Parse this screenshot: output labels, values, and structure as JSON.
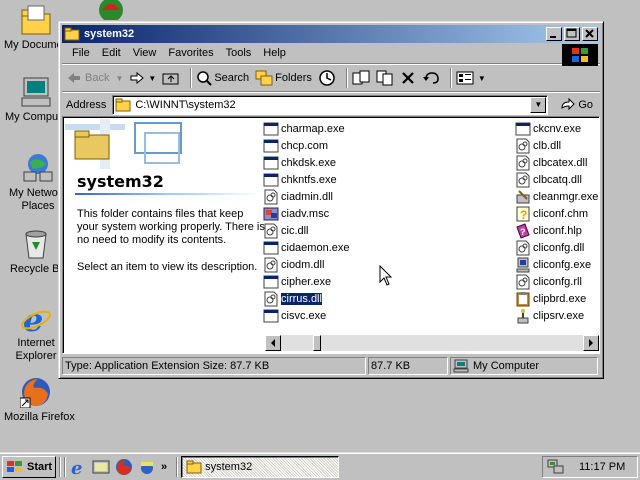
{
  "desktop": {
    "icons": [
      {
        "label": "My Documents",
        "icon": "my-documents-icon"
      },
      {
        "label": "My Computer",
        "icon": "my-computer-icon"
      },
      {
        "label": "My Network Places",
        "icon": "network-places-icon"
      },
      {
        "label": "Recycle Bin",
        "icon": "recycle-bin-icon"
      },
      {
        "label": "Internet Explorer",
        "icon": "internet-explorer-icon"
      },
      {
        "label": "Mozilla Firefox",
        "icon": "firefox-icon"
      }
    ]
  },
  "window": {
    "title": "system32",
    "menu": [
      "File",
      "Edit",
      "View",
      "Favorites",
      "Tools",
      "Help"
    ],
    "toolbar": {
      "back": "Back",
      "search": "Search",
      "folders": "Folders"
    },
    "address": {
      "label": "Address",
      "value": "C:\\WINNT\\system32",
      "go": "Go"
    },
    "left_pane": {
      "title": "system32",
      "description": "This folder contains files that keep your system working properly. There is no need to modify its contents.",
      "hint": "Select an item to view its description."
    },
    "files_col1": [
      {
        "name": "charmap.exe",
        "icon": "app-icon"
      },
      {
        "name": "chcp.com",
        "icon": "app-icon"
      },
      {
        "name": "chkdsk.exe",
        "icon": "app-icon"
      },
      {
        "name": "chkntfs.exe",
        "icon": "app-icon"
      },
      {
        "name": "ciadmin.dll",
        "icon": "dll-icon"
      },
      {
        "name": "ciadv.msc",
        "icon": "msc-icon"
      },
      {
        "name": "cic.dll",
        "icon": "dll-icon"
      },
      {
        "name": "cidaemon.exe",
        "icon": "app-icon"
      },
      {
        "name": "ciodm.dll",
        "icon": "dll-icon"
      },
      {
        "name": "cipher.exe",
        "icon": "app-icon"
      },
      {
        "name": "cirrus.dll",
        "icon": "dll-icon",
        "selected": true
      },
      {
        "name": "cisvc.exe",
        "icon": "app-icon"
      }
    ],
    "files_col2": [
      {
        "name": "ckcnv.exe",
        "icon": "app-icon"
      },
      {
        "name": "clb.dll",
        "icon": "dll-icon"
      },
      {
        "name": "clbcatex.dll",
        "icon": "dll-icon"
      },
      {
        "name": "clbcatq.dll",
        "icon": "dll-icon"
      },
      {
        "name": "cleanmgr.exe",
        "icon": "cleanmgr-icon"
      },
      {
        "name": "cliconf.chm",
        "icon": "help-icon"
      },
      {
        "name": "cliconf.hlp",
        "icon": "hlp-icon"
      },
      {
        "name": "cliconfg.dll",
        "icon": "dll-icon"
      },
      {
        "name": "cliconfg.exe",
        "icon": "cliconfg-icon"
      },
      {
        "name": "cliconfg.rll",
        "icon": "dll-icon"
      },
      {
        "name": "clipbrd.exe",
        "icon": "clipboard-icon"
      },
      {
        "name": "clipsrv.exe",
        "icon": "clipsrv-icon"
      }
    ],
    "status": {
      "info": "Type: Application Extension Size: 87.7 KB",
      "size": "87.7 KB",
      "zone": "My Computer"
    }
  },
  "taskbar": {
    "start": "Start",
    "quick_launch": [
      "internet-explorer-icon",
      "show-desktop-icon",
      "firefox-icon",
      "outlook-icon"
    ],
    "more": "»",
    "tasks": [
      {
        "label": "system32",
        "icon": "folder-icon"
      }
    ],
    "clock": "11:17 PM"
  },
  "colors": {
    "title_start": "#0a246a",
    "title_end": "#a6caf0",
    "desktop": "#c0c0c0",
    "selection": "#0a246a"
  }
}
